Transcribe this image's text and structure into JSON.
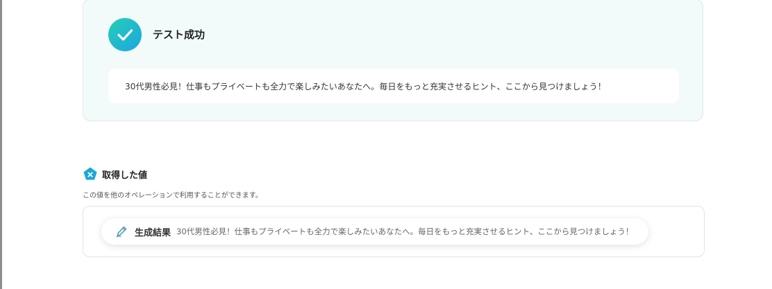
{
  "test_result": {
    "title": "テスト成功",
    "output_text": "30代男性必見！仕事もプライベートも全力で楽しみたいあなたへ。毎日をもっと充実させるヒント、ここから見つけましょう！"
  },
  "retrieved_values": {
    "title": "取得した値",
    "description": "この値を他のオペレーションで利用することができます。",
    "items": [
      {
        "label": "生成結果",
        "value": "30代男性必見！仕事もプライベートも全力で楽しみたいあなたへ。毎日をもっと充実させるヒント、ここから見つけましょう！"
      }
    ]
  },
  "colors": {
    "accent_start": "#28cdb5",
    "accent_end": "#1aa7e0",
    "panel_bg": "#f2fbfa"
  },
  "icons": {
    "success": "check-icon",
    "section": "pentagon-x-icon",
    "item": "pen-icon"
  }
}
